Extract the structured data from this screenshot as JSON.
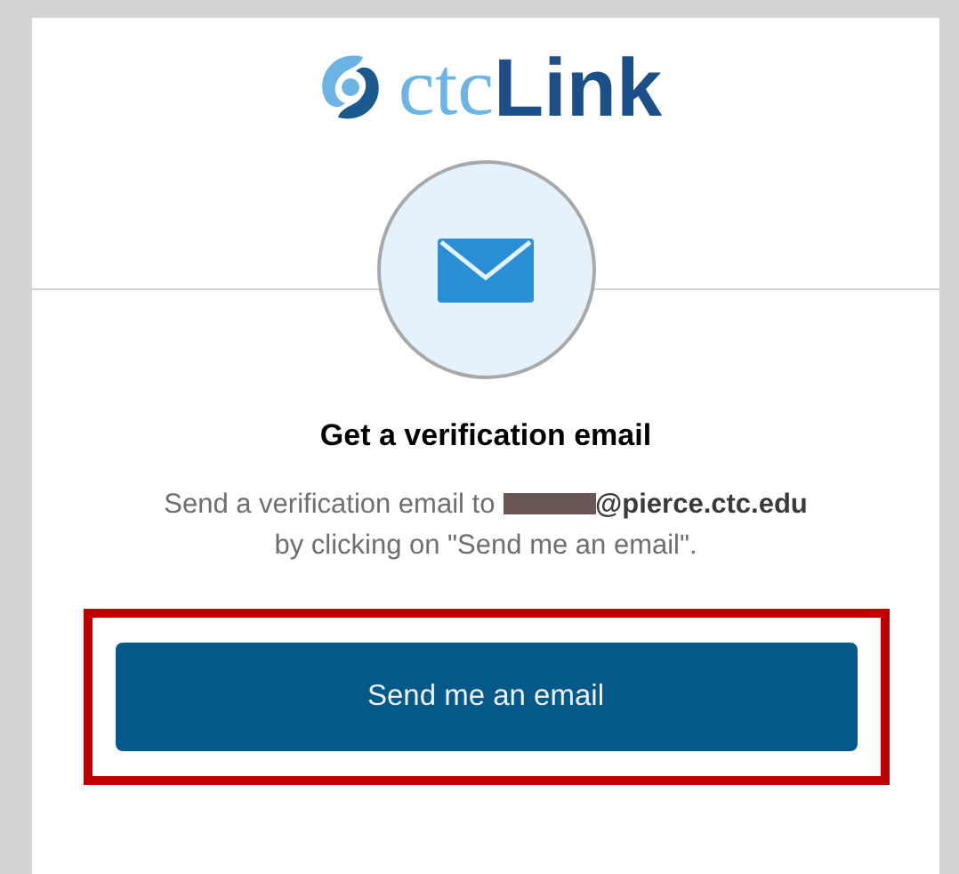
{
  "logo": {
    "light_part": "ctc",
    "bold_part": "Link"
  },
  "title": "Get a verification email",
  "message": {
    "lead": "Send a verification email to",
    "domain": "@pierce.ctc.edu",
    "tail": "by clicking on \"Send me an email\"."
  },
  "send_button": {
    "label": "Send me an email",
    "highlighted": true
  }
}
